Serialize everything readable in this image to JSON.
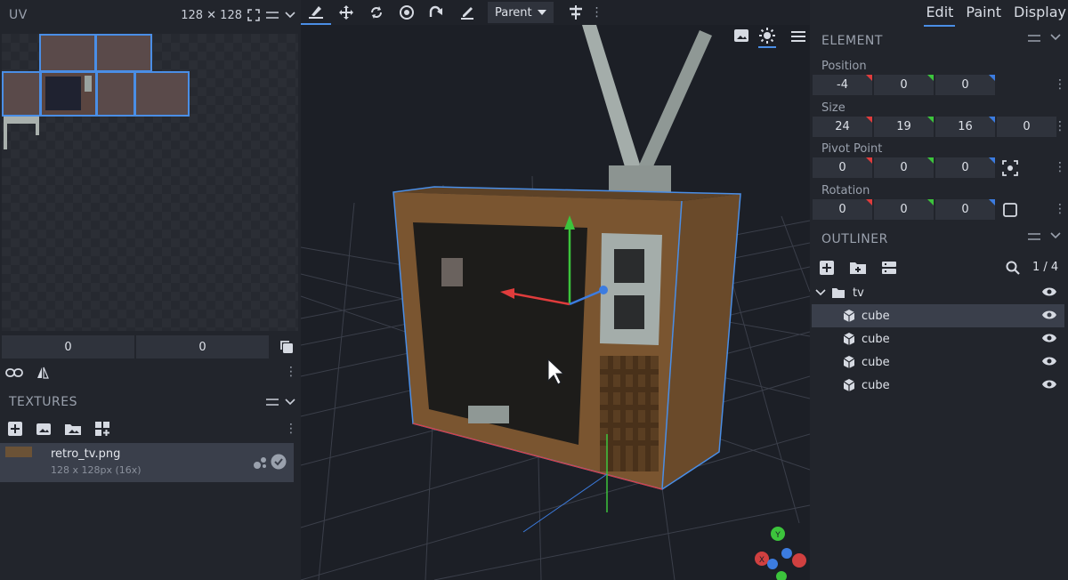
{
  "uv_panel": {
    "title": "UV",
    "resolution": "128 ✕ 128",
    "offset_x": "0",
    "offset_y": "0"
  },
  "textures_panel": {
    "title": "TEXTURES",
    "items": [
      {
        "name": "retro_tv.png",
        "info": "128 x 128px (16x)"
      }
    ]
  },
  "toolbar": {
    "space_mode": "Parent"
  },
  "tabs": {
    "edit": "Edit",
    "paint": "Paint",
    "display": "Display"
  },
  "element_panel": {
    "title": "ELEMENT",
    "position": {
      "label": "Position",
      "values": [
        "-4",
        "0",
        "0"
      ]
    },
    "size": {
      "label": "Size",
      "values": [
        "24",
        "19",
        "16",
        "0"
      ]
    },
    "pivot": {
      "label": "Pivot Point",
      "values": [
        "0",
        "0",
        "0"
      ]
    },
    "rotation": {
      "label": "Rotation",
      "values": [
        "0",
        "0",
        "0"
      ]
    }
  },
  "outliner": {
    "title": "OUTLINER",
    "count": "1 / 4",
    "group": "tv",
    "items": [
      "cube",
      "cube",
      "cube",
      "cube"
    ]
  },
  "colors": {
    "accent": "#4a8ee6",
    "axis_x": "#e03c3c",
    "axis_y": "#3cc43c",
    "axis_z": "#3c7ce0",
    "wood": "#7a5530"
  }
}
